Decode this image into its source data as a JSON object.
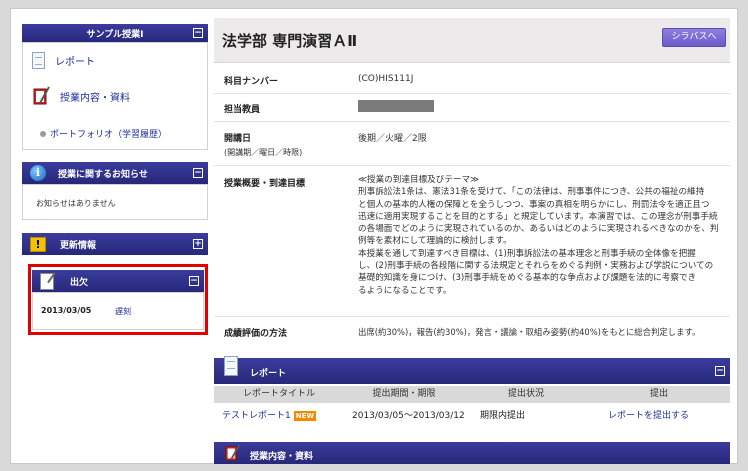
{
  "sidebar": {
    "course_title": "サンプル授業Ⅰ",
    "menu": [
      {
        "label": "レポート"
      },
      {
        "label": "授業内容・資料"
      }
    ],
    "portfolio_link": "ポートフォリオ（学習履歴）",
    "notice": {
      "title": "授業に関するお知らせ",
      "empty_text": "お知らせはありません"
    },
    "updates": {
      "title": "更新情報"
    },
    "attendance": {
      "title": "出欠",
      "date": "2013/03/05",
      "status": "遅刻"
    },
    "toggle_minus": "−",
    "toggle_plus": "+"
  },
  "header": {
    "title": "法学部  専門演習ＡⅡ",
    "syllabus_button": "シラバスへ"
  },
  "course": {
    "number_label": "科目ナンバー",
    "number_value": "(CO)HIS111J",
    "teacher_label": "担当教員",
    "schedule_label": "開講日",
    "schedule_sub": "(開講期／曜日／時限)",
    "schedule_value": "後期／火曜／2限",
    "overview_label": "授業概要・到達目標",
    "overview_lines": [
      "≪授業の到達目標及びテーマ≫",
      "刑事訴訟法1条は、憲法31条を受けて、「この法律は、刑事事件につき、公共の福祉の維持",
      "と個人の基本的人権の保障とを全うしつつ、事案の真相を明らかにし、刑罰法令を適正且つ",
      "迅速に適用実現することを目的とする」と規定しています。本演習では、この理念が刑事手続",
      "の各場面でどのように実現されているのか、あるいはどのように実現されるべきなのかを、判",
      "例等を素材にして理論的に検討します。",
      "本授業を通して到達すべき目標は、(1)刑事訴訟法の基本理念と刑事手続の全体像を把握",
      "し、(2)刑事手続の各段階に関する法規定とそれらをめぐる判例・実務および学説についての",
      "基礎的知識を身につけ、(3)刑事手続をめぐる基本的な争点および課題を法的に考察でき",
      "るようになることです。"
    ],
    "eval_label": "成績評価の方法",
    "eval_value": "出席(約30%)，報告(約30%)，発言・議論・取組み姿勢(約40%)をもとに総合判定します。"
  },
  "report_section": {
    "title": "レポート",
    "columns": [
      "レポートタイトル",
      "提出期間・期限",
      "提出状況",
      "提出"
    ],
    "rows": [
      {
        "title": "テストレポート1",
        "badge": "NEW",
        "period": "2013/03/05～2013/03/12",
        "status": "期限内提出",
        "action": "レポートを提出する"
      }
    ]
  },
  "materials_section": {
    "title": "授業内容・資料"
  }
}
